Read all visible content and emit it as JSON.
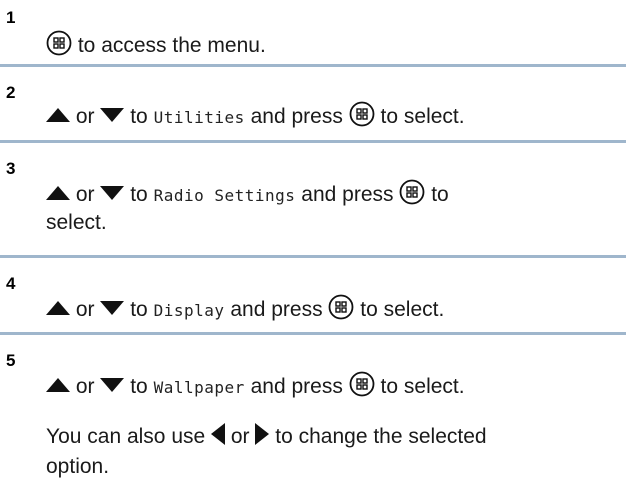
{
  "steps": [
    {
      "number": "1",
      "text_after_button": "to access the menu."
    },
    {
      "number": "2",
      "or": "or",
      "to": "to",
      "target": "Utilities",
      "and_press": "and press",
      "to_select": "to select."
    },
    {
      "number": "3",
      "or": "or",
      "to": "to",
      "target": "Radio Settings",
      "and_press": "and press",
      "to_word": "to",
      "select_word": "select."
    },
    {
      "number": "4",
      "or": "or",
      "to": "to",
      "target": "Display",
      "and_press": "and press",
      "to_select": "to select."
    },
    {
      "number": "5",
      "or": "or",
      "to": "to",
      "target": "Wallpaper",
      "and_press": "and press",
      "to_select": "to select.",
      "note_prefix": "You can also use",
      "note_or": "or",
      "note_suffix": "to change the selected",
      "note_last": "option."
    }
  ],
  "icons": {
    "menu_button": "menu-ok-button-icon",
    "up": "up-arrow-icon",
    "down": "down-arrow-icon",
    "left": "left-arrow-icon",
    "right": "right-arrow-icon"
  },
  "colors": {
    "rule": "#9fb6cc",
    "text": "#1a1a1a"
  }
}
